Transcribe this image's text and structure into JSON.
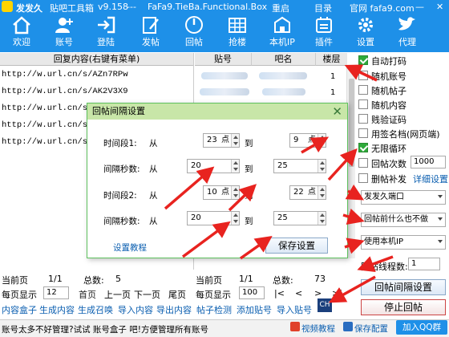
{
  "title_bar": {
    "app_name": "发发久",
    "app_subtitle": "贴吧工具箱",
    "version": "v9.158",
    "separator": "---",
    "domain": "FaFa9.TieBa.Functional.Box",
    "links": [
      "重启",
      "目录"
    ],
    "site_label": "官网 fafa9.com",
    "minimize": "—",
    "close": "✕"
  },
  "toolbar": {
    "items": [
      {
        "label": "欢迎",
        "icon": "home-icon"
      },
      {
        "label": "账号",
        "icon": "account-icon"
      },
      {
        "label": "登陆",
        "icon": "login-icon"
      },
      {
        "label": "发帖",
        "icon": "post-icon"
      },
      {
        "label": "回帖",
        "icon": "reply-icon"
      },
      {
        "label": "抢楼",
        "icon": "grab-floor-icon"
      },
      {
        "label": "本机IP",
        "icon": "ip-icon"
      },
      {
        "label": "插件",
        "icon": "plugin-icon"
      },
      {
        "label": "设置",
        "icon": "settings-icon"
      },
      {
        "label": "代理",
        "icon": "twitter-bird-icon"
      }
    ]
  },
  "left_table": {
    "header": "回复内容(右键有菜单)",
    "rows": [
      "http://w.url.cn/s/AZn7RPw",
      "http://w.url.cn/s/AK2V3X9",
      "http://w.url.cn/s/A",
      "http://w.url.cn/s/A",
      "http://w.url.cn/s/A"
    ]
  },
  "mid_table": {
    "headers": [
      "贴号",
      "吧名",
      "楼层"
    ],
    "floors": [
      "1",
      "1",
      "1"
    ]
  },
  "left_pager": {
    "current_label": "当前页",
    "current": "1/1",
    "total_label": "总数:",
    "total": "5",
    "per_page_label": "每页显示",
    "per_page": "12",
    "first": "首页",
    "prev": "上一页",
    "next": "下一页",
    "last": "尾页"
  },
  "mid_pager": {
    "current_label": "当前页",
    "current": "1/1",
    "total_label": "总数:",
    "total": "73",
    "per_page_label": "每页显示",
    "per_page": "100",
    "nav": [
      "|<",
      "<",
      ">",
      ">|"
    ]
  },
  "options": {
    "checks": [
      {
        "label": "自动打码",
        "checked": true
      },
      {
        "label": "随机账号",
        "checked": false
      },
      {
        "label": "随机帖子",
        "checked": false
      },
      {
        "label": "随机内容",
        "checked": false
      },
      {
        "label": "贱验证码",
        "checked": false
      },
      {
        "label": "用签名档(网页端)",
        "checked": false
      },
      {
        "label": "无限循环",
        "checked": true
      }
    ],
    "reply_count_label": "回帖次数",
    "reply_count": "1000",
    "delete_repost_label": "删帖补发",
    "detail_settings": "详细设置",
    "selects": [
      "发发久端口",
      "回帖前什么也不做",
      "使用本机IP"
    ],
    "threads_label": "回帖线程数:",
    "threads": "1",
    "interval_button": "回帖间隔设置",
    "stop_button": "停止回帖"
  },
  "bottom_links": [
    "内容盒子",
    "生成内容",
    "生成召唤",
    "导入内容",
    "导出内容",
    "帖子检测",
    "添加贴号",
    "导入贴号"
  ],
  "status": {
    "text": "账号太多不好管理?试试 账号盒子 吧!方便管理所有账号",
    "video": "视频教程",
    "save": "保存配置",
    "qq": "加入QQ群",
    "ime": "CH"
  },
  "dialog": {
    "title": "回帖间隔设置",
    "close": "✕",
    "rows": [
      {
        "label": "时间段1:",
        "from": "从",
        "a": "23",
        "a_unit": "点",
        "to": "到",
        "b": "9",
        "b_unit": "点"
      },
      {
        "label": "间隔秒数:",
        "from": "从",
        "a": "20",
        "a_unit": "",
        "to": "到",
        "b": "25",
        "b_unit": ""
      },
      {
        "label": "时间段2:",
        "from": "从",
        "a": "10",
        "a_unit": "点",
        "to": "到",
        "b": "22",
        "b_unit": "点"
      },
      {
        "label": "间隔秒数:",
        "from": "从",
        "a": "20",
        "a_unit": "",
        "to": "到",
        "b": "25",
        "b_unit": ""
      }
    ],
    "tutorial": "设置教程",
    "save": "保存设置"
  },
  "colors": {
    "brand": "#1e90e8",
    "annotation": "#e8231f",
    "check": "#2eaa3a"
  }
}
